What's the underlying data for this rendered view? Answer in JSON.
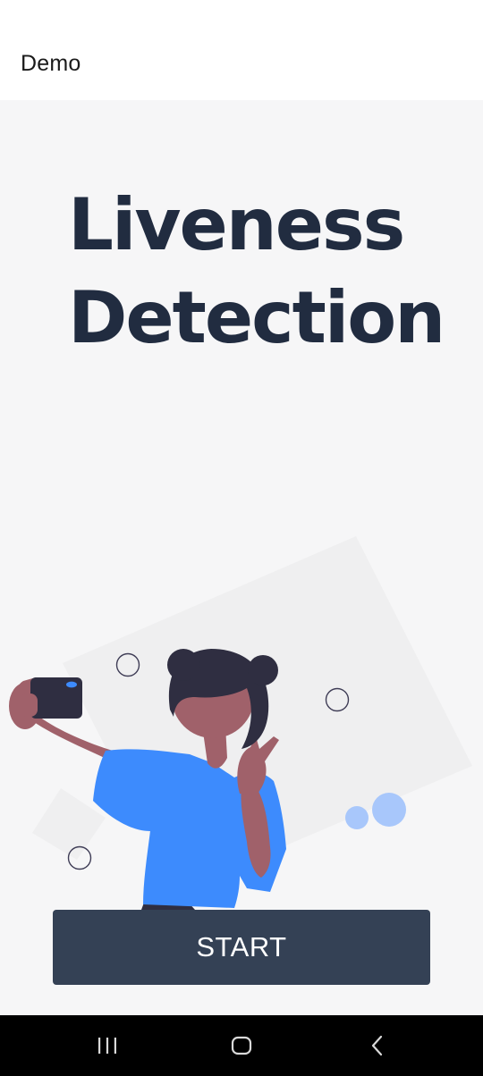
{
  "app_bar": {
    "title": "Demo"
  },
  "main": {
    "headline_line1": "Liveness",
    "headline_line2": "Detection",
    "illustration": "person-taking-selfie-illustration",
    "start_label": "START"
  },
  "colors": {
    "headline": "#212c40",
    "button": "#344155",
    "background": "#f6f6f7",
    "shirt": "#3d8bfd",
    "skin": "#a0616a",
    "hair": "#2f2e41"
  },
  "nav_bar": {
    "icons": [
      "recent-apps-icon",
      "home-icon",
      "back-icon"
    ]
  }
}
